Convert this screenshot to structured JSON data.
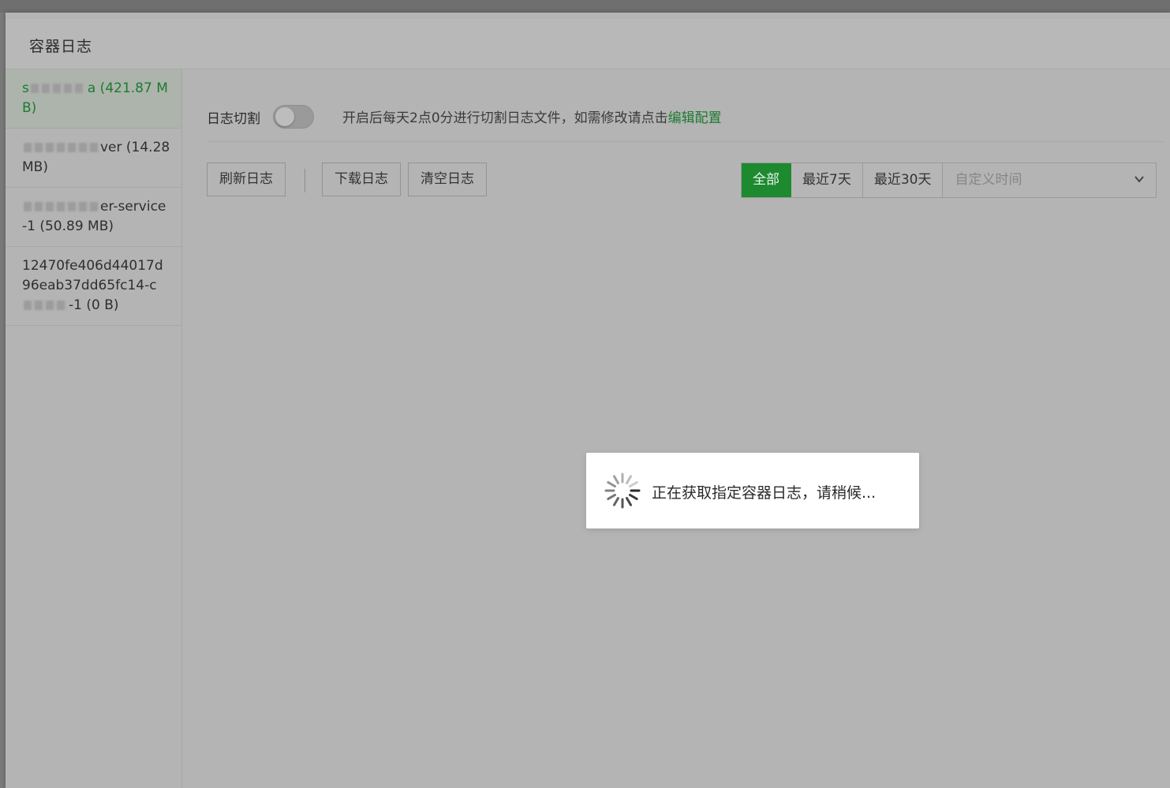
{
  "dialog": {
    "title": "容器日志"
  },
  "sidebar": {
    "items": [
      {
        "prefix": "s",
        "suffix": "a  (421.87 MB)",
        "active": true
      },
      {
        "prefix": "",
        "suffix": "ver  (14.28 MB)",
        "active": false
      },
      {
        "prefix": "",
        "suffix": "er-service-1  (50.89 MB)",
        "active": false
      },
      {
        "prefix": "12470fe406d44017d96eab37dd65fc14-c",
        "suffix": "-1  (0 B)",
        "active": false
      }
    ]
  },
  "log_split": {
    "label": "日志切割",
    "enabled": false,
    "description": "开启后每天2点0分进行切割日志文件，如需修改请点击",
    "link_text": "编辑配置"
  },
  "toolbar": {
    "refresh_label": "刷新日志",
    "download_label": "下载日志",
    "clear_label": "清空日志"
  },
  "range": {
    "all_label": "全部",
    "last7_label": "最近7天",
    "last30_label": "最近30天",
    "custom_placeholder": "自定义时间"
  },
  "loading": {
    "text": "正在获取指定容器日志，请稍候..."
  },
  "colors": {
    "accent": "#1e8a30",
    "active_text": "#1e7a30"
  }
}
